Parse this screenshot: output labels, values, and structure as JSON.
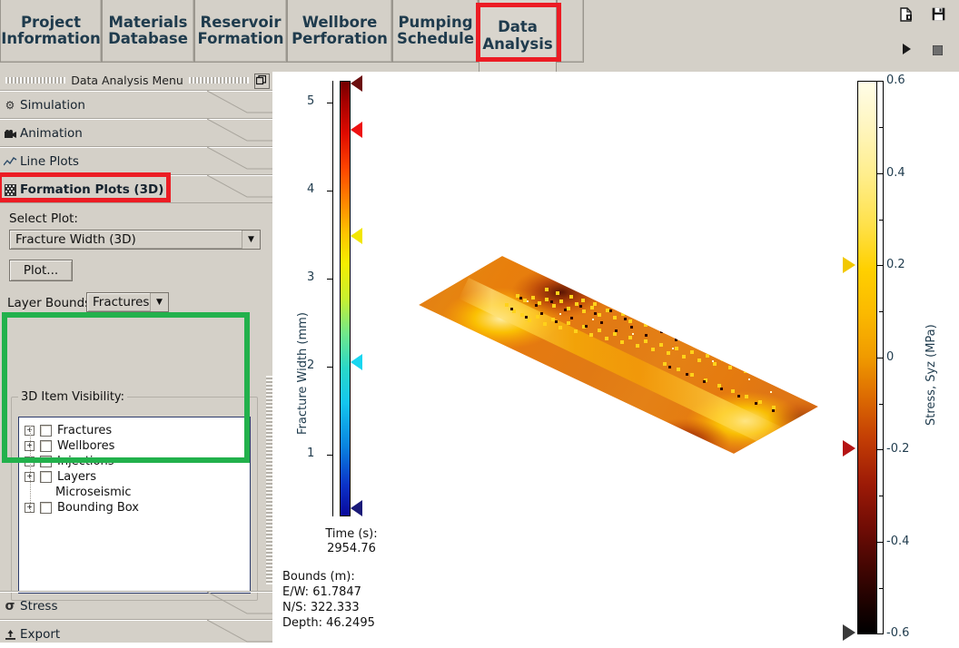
{
  "window": {
    "title": "Data Analysis"
  },
  "tabs": [
    {
      "id": "project-information",
      "line1": "Project",
      "line2": "Information",
      "active": false,
      "highlighted": false
    },
    {
      "id": "materials-database",
      "line1": "Materials",
      "line2": "Database",
      "active": false,
      "highlighted": false
    },
    {
      "id": "reservoir-formation",
      "line1": "Reservoir",
      "line2": "Formation",
      "active": false,
      "highlighted": false
    },
    {
      "id": "wellbore-perforation",
      "line1": "Wellbore",
      "line2": "Perforation",
      "active": false,
      "highlighted": false
    },
    {
      "id": "pumping-schedule",
      "line1": "Pumping",
      "line2": "Schedule",
      "active": false,
      "highlighted": false
    },
    {
      "id": "data-analysis",
      "line1": "Data",
      "line2": "Analysis",
      "active": true,
      "highlighted": true
    }
  ],
  "toolbar": {
    "icons": [
      {
        "id": "new-document-icon",
        "glyph": "❐"
      },
      {
        "id": "save-icon",
        "glyph": "ὋE"
      },
      {
        "id": "run-icon",
        "glyph": "▶"
      },
      {
        "id": "stop-icon",
        "glyph": "■"
      }
    ]
  },
  "sidebar": {
    "header_title": "Data Analysis Menu",
    "float_button": "⧉",
    "accordion": [
      {
        "id": "simulation",
        "label": "Simulation",
        "icon": "gear-icon",
        "glyph": "⚙",
        "selected": false,
        "highlighted": false
      },
      {
        "id": "animation",
        "label": "Animation",
        "icon": "film-icon",
        "glyph": "♣",
        "selected": false,
        "highlighted": false
      },
      {
        "id": "line-plots",
        "label": "Line Plots",
        "icon": "line-chart-icon",
        "glyph": "↗",
        "selected": false,
        "highlighted": false
      },
      {
        "id": "formation-plots-3d",
        "label": "Formation Plots (3D)",
        "icon": "grid-3d-icon",
        "glyph": "▓",
        "selected": true,
        "highlighted": true
      }
    ],
    "accordion_bottom": [
      {
        "id": "stress",
        "label": "Stress",
        "icon": "sigma-icon",
        "glyph": "σ"
      },
      {
        "id": "export",
        "label": "Export",
        "icon": "export-icon",
        "glyph": "⤓"
      }
    ],
    "select_plot_label": "Select Plot:",
    "select_plot_value": "Fracture Width (3D)",
    "plot_button_label": "Plot...",
    "layer_bounds_label": "Layer Bounds:",
    "layer_bounds_value": "Fractures",
    "group_title": "3D Item Visibility:",
    "tree_items": [
      {
        "id": "fractures",
        "label": "Fractures",
        "expander": "+",
        "checkbox": true,
        "checked": false
      },
      {
        "id": "wellbores",
        "label": "Wellbores",
        "expander": "+",
        "checkbox": true,
        "checked": false
      },
      {
        "id": "injections",
        "label": "Injections",
        "expander": "+",
        "checkbox": true,
        "checked": false
      },
      {
        "id": "layers",
        "label": "Layers",
        "expander": "+",
        "checkbox": true,
        "checked": false
      },
      {
        "id": "microseismic",
        "label": "Microseismic",
        "expander": "",
        "checkbox": false,
        "checked": false
      },
      {
        "id": "bounding-box",
        "label": "Bounding Box",
        "expander": "+",
        "checkbox": true,
        "checked": false
      }
    ]
  },
  "highlights": {
    "tab_color": "#ec1c24",
    "menu_item_color": "#ec1c24",
    "group_color": "#22b14c"
  },
  "plot": {
    "info_time_label": "Time (s):",
    "info_time_value": "2954.76",
    "info_bounds_label": "Bounds (m):",
    "info_bounds_ew": "E/W: 61.7847",
    "info_bounds_ns": "N/S: 322.333",
    "info_bounds_depth": "Depth: 46.2495"
  },
  "chart_data": {
    "type": "heatmap",
    "title": "",
    "description": "3D fracture-plane surface plot colored by Stress, Syz, shown as an oblique parallelogram sheet",
    "colorbars": [
      {
        "id": "fracture-width-colorbar",
        "position": "left",
        "label": "Fracture Width (mm)",
        "colormap": "jet",
        "ticks": [
          5,
          4,
          3,
          2,
          1
        ],
        "tick_labels": [
          "5",
          "4",
          "3",
          "2",
          "1"
        ],
        "range": [
          0.75,
          5.25
        ],
        "markers": [
          {
            "id": "marker-max",
            "value": 5.25,
            "color": "#6b0f0f"
          },
          {
            "id": "marker-upper",
            "value": 4.62,
            "color": "#ee1111"
          },
          {
            "id": "marker-mid",
            "value": 3.48,
            "color": "#f2e600"
          },
          {
            "id": "marker-lower",
            "value": 2.07,
            "color": "#19d6f0"
          },
          {
            "id": "marker-min",
            "value": 0.75,
            "color": "#1a1a78"
          }
        ]
      },
      {
        "id": "stress-syz-colorbar",
        "position": "right",
        "label": "Stress, Syz (MPa)",
        "colormap": "hot-reversed",
        "ticks": [
          0.6,
          0.4,
          0.2,
          0,
          -0.2,
          -0.4,
          -0.6
        ],
        "tick_labels": [
          "0.6",
          "0.4",
          "0.2",
          "0",
          "-0.2",
          "-0.4",
          "-0.6"
        ],
        "minor_ticks": [
          0.5,
          0.3,
          0.1,
          -0.1,
          -0.3,
          -0.5
        ],
        "range": [
          -0.6,
          0.6
        ],
        "markers": [
          {
            "id": "marker-upper",
            "value": 0.2,
            "color": "#f2c800"
          },
          {
            "id": "marker-lower",
            "value": -0.2,
            "color": "#b51414"
          },
          {
            "id": "marker-min",
            "value": -0.6,
            "color": "#2b2b2b"
          }
        ]
      }
    ]
  }
}
